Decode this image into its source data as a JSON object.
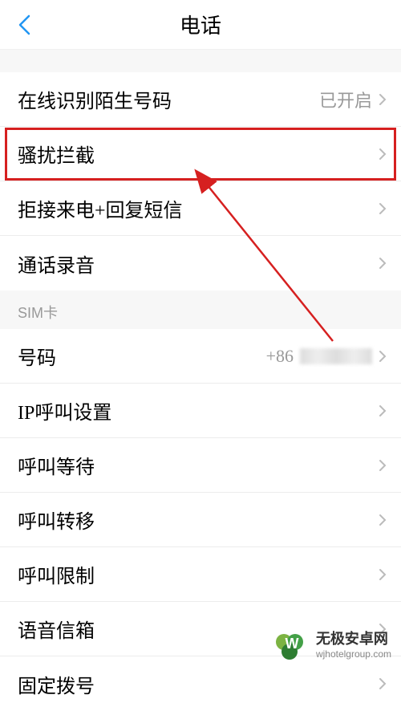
{
  "header": {
    "title": "电话"
  },
  "items": {
    "online_id": {
      "label": "在线识别陌生号码",
      "value": "已开启"
    },
    "block": {
      "label": "骚扰拦截"
    },
    "reject_reply": {
      "label": "拒接来电+回复短信"
    },
    "call_record": {
      "label": "通话录音"
    },
    "sim_section": {
      "label": "SIM卡"
    },
    "number": {
      "label": "号码",
      "value": "+86"
    },
    "ip_call": {
      "label": "IP呼叫设置"
    },
    "call_wait": {
      "label": "呼叫等待"
    },
    "call_forward": {
      "label": "呼叫转移"
    },
    "call_limit": {
      "label": "呼叫限制"
    },
    "voicemail": {
      "label": "语音信箱"
    },
    "fixed_dial": {
      "label": "固定拨号"
    }
  },
  "watermark": {
    "title": "无极安卓网",
    "url": "wjhotelgroup.com"
  },
  "annotation": {
    "highlight_item": "骚扰拦截"
  }
}
